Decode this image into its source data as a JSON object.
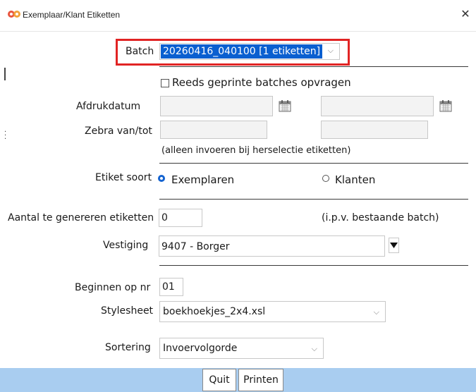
{
  "window": {
    "title": "Exemplaar/Klant Etiketten",
    "close_glyph": "✕",
    "icon": "app-logo-icon"
  },
  "batch": {
    "label": "Batch",
    "value": "20260416_040100 [1 etiketten]",
    "highlight_color": "#e12424"
  },
  "reprint": {
    "label": "Reeds geprinte batches opvragen",
    "checked": false
  },
  "print_date": {
    "label": "Afdrukdatum",
    "from_value": "",
    "to_value": ""
  },
  "zebra": {
    "label": "Zebra van/tot",
    "from_value": "",
    "to_value": ""
  },
  "hint": "(alleen invoeren bij herselectie etiketten)",
  "label_type": {
    "label": "Etiket soort",
    "options": [
      "Exemplaren",
      "Klanten"
    ],
    "selected": "Exemplaren"
  },
  "count": {
    "label": "Aantal te genereren etiketten",
    "value": "0",
    "note": "(i.p.v. bestaande batch)"
  },
  "branch": {
    "label": "Vestiging",
    "value": "9407 - Borger"
  },
  "start_nr": {
    "label": "Beginnen op nr",
    "value": "01"
  },
  "stylesheet": {
    "label": "Stylesheet",
    "value": "boekhoekjes_2x4.xsl"
  },
  "sort": {
    "label": "Sortering",
    "value": "Invoervolgorde"
  },
  "footer": {
    "quit_label": "Quit",
    "print_label": "Printen",
    "bg_color": "#a9cdf0"
  }
}
